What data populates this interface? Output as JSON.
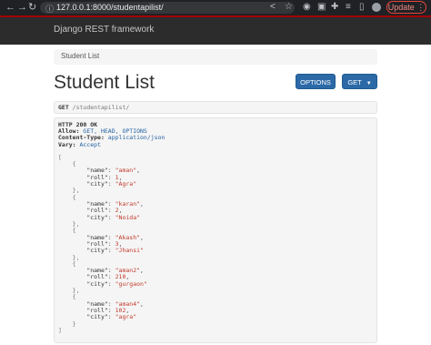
{
  "browser": {
    "url": "127.0.0.1:8000/studentapilist/",
    "update_label": "Update",
    "update_menu": "⋮"
  },
  "navbar": {
    "brand": "Django REST framework"
  },
  "breadcrumb": {
    "label": "Student List"
  },
  "page": {
    "title": "Student List"
  },
  "buttons": {
    "options": "OPTIONS",
    "get": "GET"
  },
  "request": {
    "method": "GET",
    "path": "/studentapilist/"
  },
  "response": {
    "status": "HTTP 200 OK",
    "headers": [
      {
        "name": "Allow:",
        "value": "GET, HEAD, OPTIONS"
      },
      {
        "name": "Content-Type:",
        "value": "application/json"
      },
      {
        "name": "Vary:",
        "value": "Accept"
      }
    ],
    "students": [
      {
        "name": "aman",
        "roll": 1,
        "city": "Agra"
      },
      {
        "name": "karan",
        "roll": 2,
        "city": "Noida"
      },
      {
        "name": "Akash",
        "roll": 3,
        "city": "Jhansi"
      },
      {
        "name": "aman2",
        "roll": 210,
        "city": "gurgaon"
      },
      {
        "name": "aman4",
        "roll": 102,
        "city": "agra"
      }
    ]
  }
}
